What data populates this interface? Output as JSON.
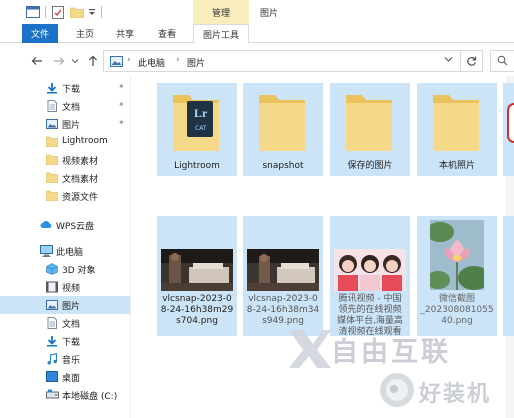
{
  "titlebar": {
    "context_tab": "管理",
    "window_title": "图片"
  },
  "ribbon": {
    "tabs": [
      {
        "label": "文件"
      },
      {
        "label": "主页"
      },
      {
        "label": "共享"
      },
      {
        "label": "查看"
      },
      {
        "label": "图片工具"
      }
    ]
  },
  "address": {
    "crumbs": [
      "此电脑",
      "图片"
    ]
  },
  "sidebar": {
    "items": [
      {
        "label": "下载",
        "icon": "download-icon",
        "pinned": true
      },
      {
        "label": "文档",
        "icon": "document-icon",
        "pinned": true
      },
      {
        "label": "图片",
        "icon": "pictures-icon",
        "pinned": true
      },
      {
        "label": "Lightroom",
        "icon": "folder-icon"
      },
      {
        "label": "视频素材",
        "icon": "folder-icon"
      },
      {
        "label": "文档素材",
        "icon": "folder-icon"
      },
      {
        "label": "资源文件",
        "icon": "folder-icon"
      },
      {
        "label": "WPS云盘",
        "icon": "cloud-icon"
      },
      {
        "label": "此电脑",
        "icon": "computer-icon"
      },
      {
        "label": "3D 对象",
        "icon": "3d-objects-icon"
      },
      {
        "label": "视频",
        "icon": "video-icon"
      },
      {
        "label": "图片",
        "icon": "pictures-icon",
        "selected": true
      },
      {
        "label": "文档",
        "icon": "document-icon"
      },
      {
        "label": "下载",
        "icon": "download-icon"
      },
      {
        "label": "音乐",
        "icon": "music-icon"
      },
      {
        "label": "桌面",
        "icon": "desktop-icon"
      },
      {
        "label": "本地磁盘 (C:)",
        "icon": "drive-icon"
      }
    ]
  },
  "folders": [
    {
      "name": "Lightroom",
      "badge_main": "Lr",
      "badge_sub": "CAT"
    },
    {
      "name": "snapshot"
    },
    {
      "name": "保存的图片"
    },
    {
      "name": "本机照片"
    }
  ],
  "files": [
    {
      "lines": [
        "vlcsnap-2023-0",
        "8-24-16h38m29",
        "s704.png"
      ]
    },
    {
      "lines": [
        "vlcsnap-2023-0",
        "8-24-16h38m34",
        "s949.png"
      ]
    },
    {
      "lines": [
        "腾讯视频 - 中国",
        "领先的在线视频",
        "媒体平台,海量高",
        "清视频在线观看"
      ]
    },
    {
      "lines": [
        "微信截图",
        "_202308081055",
        "40.png"
      ]
    }
  ],
  "watermark": {
    "line1": "自由互联",
    "line2": "好装机"
  },
  "colors": {
    "accent": "#1a73c7",
    "selection": "#cce4f7",
    "context_tab": "#f8eebd",
    "folder": "#f5d889"
  }
}
